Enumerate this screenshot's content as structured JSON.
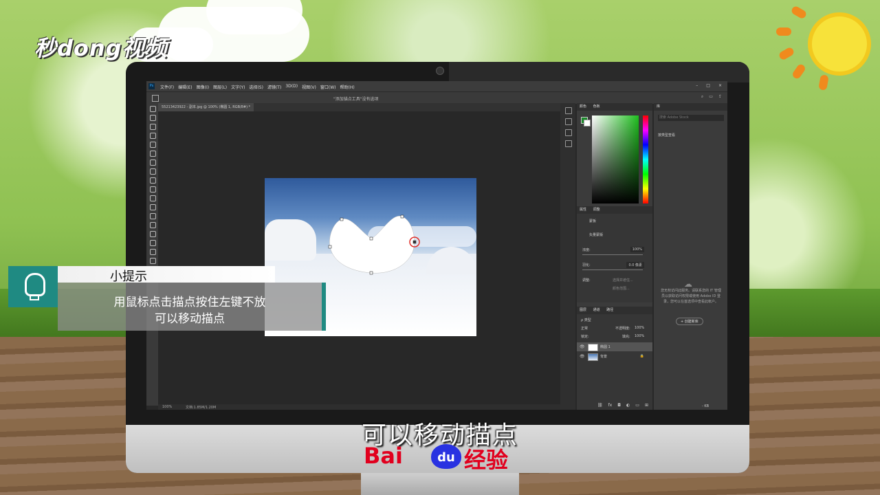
{
  "brand": {
    "top_logo": "秒dong视频",
    "baidu_left": "Bai",
    "baidu_mid": "du",
    "baidu_right": "经验"
  },
  "photoshop": {
    "app_icon": "Ps",
    "menus": [
      "文件(F)",
      "编辑(E)",
      "图像(I)",
      "图层(L)",
      "文字(Y)",
      "选择(S)",
      "滤镜(T)",
      "3D(D)",
      "视图(V)",
      "窗口(W)",
      "帮助(H)"
    ],
    "window_controls": [
      "–",
      "□",
      "×"
    ],
    "options_title": "\"添加锚点工具\"没有选项",
    "doc_tab": "55213423922 - 副本.jpg @ 100% (椭圆 1, RGB/8#) *",
    "status_zoom": "100%",
    "status_doc": "文档:1.85M/1.20M",
    "panels": {
      "color_tabs": [
        "颜色",
        "色板"
      ],
      "props_tabs": [
        "属性",
        "调整"
      ],
      "props_mask": "蒙板",
      "props_vector": "矢量蒙版",
      "density_label": "浓度:",
      "density_value": "100%",
      "feather_label": "羽化:",
      "feather_value": "0.0 像素",
      "adjust_label": "调整:",
      "btn_select_mask": "选择并遮住...",
      "btn_invert": "颜色范围...",
      "layers_tabs": [
        "图层",
        "通道",
        "路径"
      ],
      "layers_filter": "ρ 类型",
      "blend_mode": "正常",
      "opacity_label": "不透明度:",
      "opacity_value": "100%",
      "lock_label": "锁定:",
      "fill_label": "填充:",
      "fill_value": "100%",
      "layers": [
        {
          "name": "椭圆 1"
        },
        {
          "name": "背景"
        }
      ],
      "lib_tab": "库",
      "lib_search_placeholder": "搜索 Adobe Stock",
      "lib_filter": "按类型查看",
      "lib_message": "您无权访问此服务。请联系您的 IT 管理员以获取访问权限或使用 Adobe ID 登录，您可以在首选项中查看此帐户。",
      "lib_button": "+ 创建新库",
      "lib_footer": "- KB"
    }
  },
  "tip": {
    "title": "小提示",
    "line1": "用鼠标点击描点按住左键不放",
    "line2": "可以移动描点"
  },
  "subtitle": "可以移动描点",
  "colors": {
    "accent": "#1f8a82",
    "baidu_red": "#e1001e",
    "baidu_blue": "#2932e1"
  }
}
